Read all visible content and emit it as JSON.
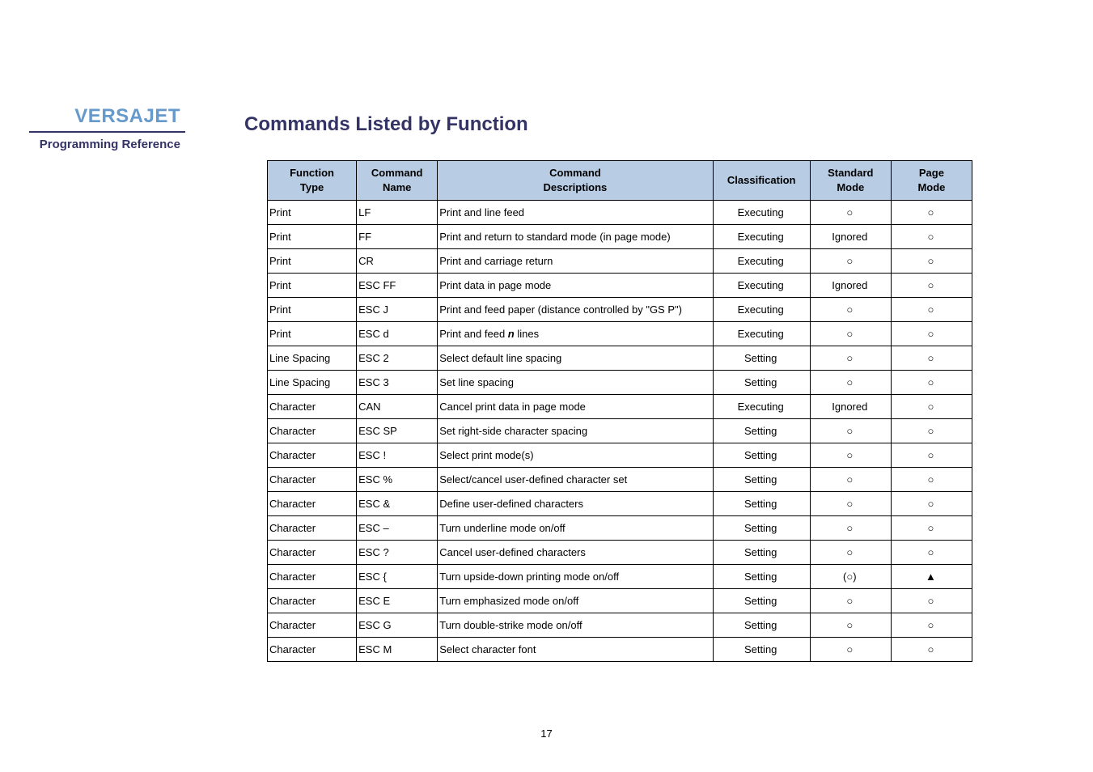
{
  "sidebar": {
    "brand": "VERSAJET",
    "subtitle": "Programming Reference"
  },
  "heading": "Commands Listed by Function",
  "headers": {
    "function_type_1": "Function",
    "function_type_2": "Type",
    "command_name_1": "Command",
    "command_name_2": "Name",
    "command_desc_1": "Command",
    "command_desc_2": "Descriptions",
    "classification": "Classification",
    "standard_mode_1": "Standard",
    "standard_mode_2": "Mode",
    "page_mode_1": "Page",
    "page_mode_2": "Mode"
  },
  "rows": [
    {
      "ft": "Print",
      "cn": "LF",
      "cd": "Print and line feed",
      "cl": "Executing",
      "sm": "○",
      "pm": "○"
    },
    {
      "ft": "Print",
      "cn": "FF",
      "cd": "Print and return to standard mode (in page mode)",
      "cl": "Executing",
      "sm": "Ignored",
      "pm": "○"
    },
    {
      "ft": "Print",
      "cn": "CR",
      "cd": "Print and carriage return",
      "cl": "Executing",
      "sm": "○",
      "pm": "○"
    },
    {
      "ft": "Print",
      "cn": "ESC FF",
      "cd": "Print data in page mode",
      "cl": "Executing",
      "sm": "Ignored",
      "pm": "○"
    },
    {
      "ft": "Print",
      "cn": "ESC J",
      "cd": "Print and feed paper (distance controlled by \"GS P\")",
      "cl": "Executing",
      "sm": "○",
      "pm": "○"
    },
    {
      "ft": "Print",
      "cn": "ESC d",
      "cd_prefix": "Print and feed ",
      "cd_italic": "n",
      "cd_suffix": " lines",
      "cl": "Executing",
      "sm": "○",
      "pm": "○"
    },
    {
      "ft": "Line Spacing",
      "cn": "ESC 2",
      "cd": "Select default line spacing",
      "cl": "Setting",
      "sm": "○",
      "pm": "○"
    },
    {
      "ft": "Line Spacing",
      "cn": "ESC 3",
      "cd": "Set line spacing",
      "cl": "Setting",
      "sm": "○",
      "pm": "○"
    },
    {
      "ft": "Character",
      "cn": "CAN",
      "cd": "Cancel print data in page mode",
      "cl": "Executing",
      "sm": "Ignored",
      "pm": "○"
    },
    {
      "ft": "Character",
      "cn": "ESC SP",
      "cd": "Set right-side character spacing",
      "cl": "Setting",
      "sm": "○",
      "pm": "○"
    },
    {
      "ft": "Character",
      "cn": "ESC !",
      "cd": "Select print mode(s)",
      "cl": "Setting",
      "sm": "○",
      "pm": "○"
    },
    {
      "ft": "Character",
      "cn": "ESC %",
      "cd": "Select/cancel user-defined character set",
      "cl": "Setting",
      "sm": "○",
      "pm": "○"
    },
    {
      "ft": "Character",
      "cn": "ESC &",
      "cd": "Define user-defined characters",
      "cl": "Setting",
      "sm": "○",
      "pm": "○"
    },
    {
      "ft": "Character",
      "cn": "ESC –",
      "cd": "Turn underline mode on/off",
      "cl": "Setting",
      "sm": "○",
      "pm": "○"
    },
    {
      "ft": "Character",
      "cn": "ESC ?",
      "cd": "Cancel user-defined characters",
      "cl": "Setting",
      "sm": "○",
      "pm": "○"
    },
    {
      "ft": "Character",
      "cn": "ESC {",
      "cd": "Turn upside-down printing mode on/off",
      "cl": "Setting",
      "sm": "(○)",
      "pm": "▲"
    },
    {
      "ft": "Character",
      "cn": "ESC E",
      "cd": "Turn emphasized mode on/off",
      "cl": "Setting",
      "sm": "○",
      "pm": "○"
    },
    {
      "ft": "Character",
      "cn": "ESC G",
      "cd": "Turn double-strike mode on/off",
      "cl": "Setting",
      "sm": "○",
      "pm": "○"
    },
    {
      "ft": "Character",
      "cn": "ESC M",
      "cd": "Select character font",
      "cl": "Setting",
      "sm": "○",
      "pm": "○"
    }
  ],
  "page_number": "17"
}
